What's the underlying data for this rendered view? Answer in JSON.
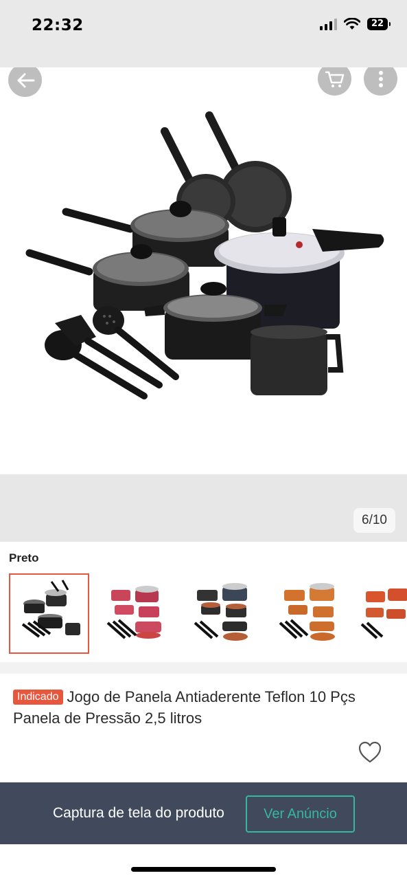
{
  "status_bar": {
    "time": "22:32",
    "battery": "22",
    "icons": [
      "signal-icon",
      "wifi-icon",
      "battery-icon"
    ]
  },
  "header": {
    "icons": [
      "back-arrow-icon",
      "cart-icon",
      "more-vertical-icon"
    ]
  },
  "gallery": {
    "current": 6,
    "total": 10,
    "counter": "6/10"
  },
  "variants": {
    "label": "Preto",
    "selected_index": 0,
    "options": [
      {
        "color": "black"
      },
      {
        "color": "red"
      },
      {
        "color": "copper-black"
      },
      {
        "color": "orange"
      },
      {
        "color": "orange-red"
      }
    ]
  },
  "product": {
    "badge": "Indicado",
    "title": "Jogo de Panela Antiaderente Teflon 10 Pçs Panela de Pressão 2,5 litros"
  },
  "bottom_bar": {
    "caption": "Captura de tela do produto",
    "button": "Ver Anúncio"
  },
  "colors": {
    "accent_badge": "#e7573d",
    "bottom_bar_bg": "#414a5c",
    "button_teal": "#35b89f"
  }
}
